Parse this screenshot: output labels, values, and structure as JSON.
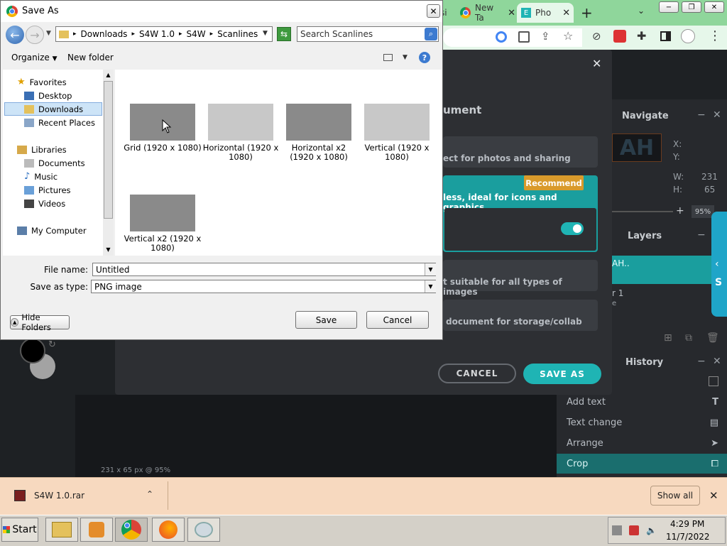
{
  "browser": {
    "tabs": [
      {
        "label": "si"
      },
      {
        "label": "New Ta"
      },
      {
        "label": "Pho"
      }
    ],
    "new_tab": "+",
    "window_controls": [
      "−",
      "❐",
      "✕"
    ]
  },
  "app": {
    "close": "✕",
    "modal_heading_partial": "ument",
    "options": [
      {
        "desc": "ect for photos and sharing"
      },
      {
        "desc": "less, ideal for icons and graphics",
        "badge": "Recommend"
      },
      {
        "desc": "t suitable for all types of images"
      },
      {
        "desc": "document for storage/collab"
      }
    ],
    "cancel_label": "CANCEL",
    "save_as_label": "SAVE AS",
    "navigate": {
      "title": "Navigate",
      "preview_text": "AH",
      "x_label": "X:",
      "y_label": "Y:",
      "w_label": "W:",
      "w_value": "231",
      "h_label": "H:",
      "h_value": "65",
      "zoom": "95%"
    },
    "layers": {
      "title": "Layers",
      "item1": "AH..",
      "item2": "r 1",
      "item2_sub": "e"
    },
    "history": {
      "title": "History",
      "items": [
        "Add text",
        "Text change",
        "Arrange",
        "Crop"
      ]
    },
    "canvas_status": "231 x 65 px @ 95%"
  },
  "download_bar": {
    "file": "S4W 1.0.rar",
    "show_all": "Show all"
  },
  "taskbar": {
    "start": "Start",
    "time": "4:29 PM",
    "date": "11/7/2022"
  },
  "dialog": {
    "title": "Save As",
    "breadcrumb": [
      "Downloads",
      "S4W 1.0",
      "S4W",
      "Scanlines"
    ],
    "search_placeholder": "Search Scanlines",
    "organize": "Organize",
    "new_folder": "New folder",
    "nav": {
      "favorites": "Favorites",
      "desktop": "Desktop",
      "downloads": "Downloads",
      "recent": "Recent Places",
      "libraries": "Libraries",
      "documents": "Documents",
      "music": "Music",
      "pictures": "Pictures",
      "videos": "Videos",
      "computer": "My Computer"
    },
    "files": [
      {
        "name": "Grid (1920 x 1080)"
      },
      {
        "name": "Horizontal (1920 x 1080)"
      },
      {
        "name": "Horizontal x2 (1920 x 1080)"
      },
      {
        "name": "Vertical (1920 x 1080)"
      },
      {
        "name": "Vertical x2 (1920 x 1080)"
      }
    ],
    "file_name_label": "File name:",
    "file_name_value": "Untitled",
    "save_type_label": "Save as type:",
    "save_type_value": "PNG image",
    "hide_folders": "Hide Folders",
    "save": "Save",
    "cancel": "Cancel"
  }
}
